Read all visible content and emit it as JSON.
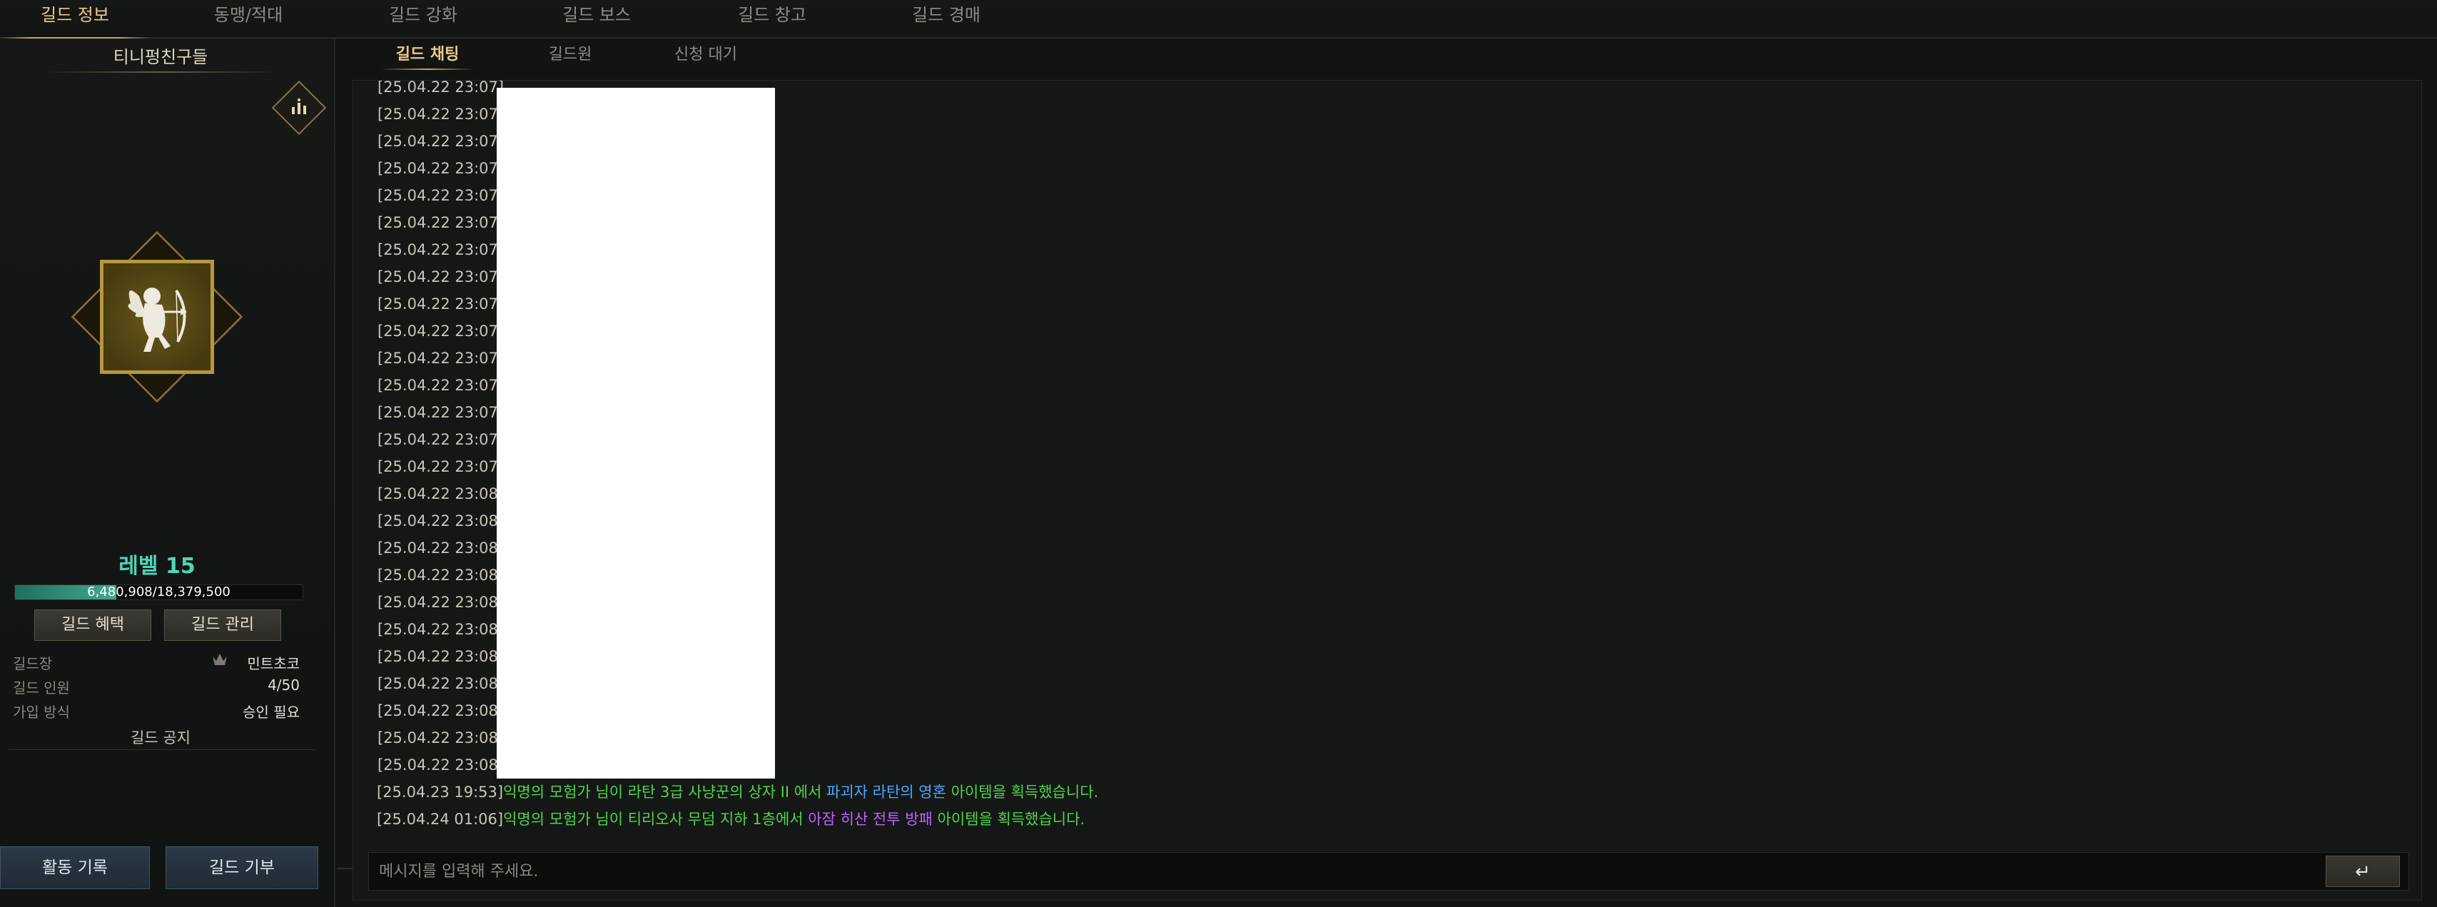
{
  "top_tabs": [
    {
      "label": "길드 정보"
    },
    {
      "label": "동맹/적대"
    },
    {
      "label": "길드 강화"
    },
    {
      "label": "길드 보스"
    },
    {
      "label": "길드 창고"
    },
    {
      "label": "길드 경매"
    }
  ],
  "guild": {
    "name": "티니펑친구들",
    "level": "레벨 15",
    "xp_text": "6,480,908/18,379,500",
    "xp_fraction": 0.3526,
    "benefits_label": "길드 혜택",
    "manage_label": "길드 관리",
    "leader_label": "길드장",
    "leader_value": "민트초코",
    "members_label": "길드 인원",
    "members_value": "4/50",
    "join_label": "가입 방식",
    "join_value": "승인 필요",
    "notice_label": "길드 공지",
    "activity_label": "활동 기록",
    "donate_label": "길드 기부"
  },
  "sub_tabs": [
    {
      "label": "길드 채팅"
    },
    {
      "label": "길드원"
    },
    {
      "label": "신청 대기"
    }
  ],
  "chat": {
    "timestamps": [
      "[25.04.22 23:07]",
      "[25.04.22 23:07]",
      "[25.04.22 23:07]",
      "[25.04.22 23:07]",
      "[25.04.22 23:07]",
      "[25.04.22 23:07]",
      "[25.04.22 23:07]",
      "[25.04.22 23:07]",
      "[25.04.22 23:07]",
      "[25.04.22 23:07]",
      "[25.04.22 23:07]",
      "[25.04.22 23:07]",
      "[25.04.22 23:07]",
      "[25.04.22 23:07]",
      "[25.04.22 23:07]",
      "[25.04.22 23:08]",
      "[25.04.22 23:08]",
      "[25.04.22 23:08]",
      "[25.04.22 23:08]",
      "[25.04.22 23:08]",
      "[25.04.22 23:08]",
      "[25.04.22 23:08]",
      "[25.04.22 23:08]",
      "[25.04.22 23:08]",
      "[25.04.22 23:08]",
      "[25.04.22 23:08]"
    ],
    "system_msg_1": {
      "time": "[25.04.23 19:53]",
      "part1": "익명의 모험가 님이 라탄 3급 사냥꾼의 상자 II 에서 ",
      "item": "파괴자 라탄의 영혼",
      "part2": " 아이템을 획득했습니다."
    },
    "system_msg_2": {
      "time": "[25.04.24 01:06]",
      "part1": "익명의 모험가 님이 티리오사 무덤 지하 1층에서 ",
      "item": "아잠 히산 전투 방패",
      "part2": " 아이템을 획득했습니다."
    },
    "input_placeholder": "메시지를 입력해 주세요.",
    "send_icon": "↵"
  },
  "colors": {
    "active_tab": "#e9c98a",
    "level": "#4fd5b9",
    "system_green": "#4fd54a",
    "item_blue": "#49a8ff",
    "item_purple": "#c062ff"
  }
}
